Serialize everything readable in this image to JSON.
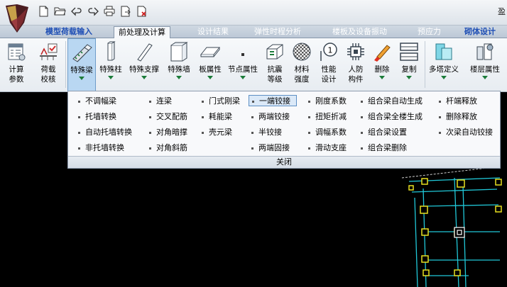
{
  "title": {
    "text": "盈"
  },
  "quick_access": [
    {
      "icon": "new-file-icon"
    },
    {
      "icon": "open-folder-icon"
    },
    {
      "icon": "undo-icon"
    },
    {
      "icon": "redo-icon"
    },
    {
      "icon": "print-icon"
    },
    {
      "icon": "export-icon"
    },
    {
      "icon": "close-file-icon"
    }
  ],
  "tabs": [
    {
      "label": "模型荷载输入"
    },
    {
      "label": "前处理及计算"
    },
    {
      "label": "设计结果"
    },
    {
      "label": "弹性时程分析"
    },
    {
      "label": "楼板及设备振动"
    },
    {
      "label": "预应力"
    },
    {
      "label": "砌体设计"
    }
  ],
  "ribbon": [
    {
      "label1": "计算",
      "label2": "参数",
      "icon": "calc-params-icon"
    },
    {
      "label1": "荷载",
      "label2": "校核",
      "icon": "load-check-icon"
    },
    {
      "label1": "特殊梁",
      "label2": "",
      "icon": "special-beam-icon"
    },
    {
      "label1": "特殊柱",
      "label2": "",
      "icon": "special-column-icon"
    },
    {
      "label1": "特殊支撑",
      "label2": "",
      "icon": "special-brace-icon"
    },
    {
      "label1": "特殊墙",
      "label2": "",
      "icon": "special-wall-icon"
    },
    {
      "label1": "板属性",
      "label2": "",
      "icon": "slab-property-icon"
    },
    {
      "label1": "节点属性",
      "label2": "",
      "icon": "node-property-icon"
    },
    {
      "label1": "抗震",
      "label2": "等级",
      "icon": "seismic-grade-icon"
    },
    {
      "label1": "材料",
      "label2": "强度",
      "icon": "material-strength-icon"
    },
    {
      "label1": "性能",
      "label2": "设计",
      "icon": "performance-design-icon"
    },
    {
      "label1": "人防",
      "label2": "构件",
      "icon": "civil-defense-icon"
    },
    {
      "label1": "删除",
      "label2": "",
      "icon": "delete-icon"
    },
    {
      "label1": "复制",
      "label2": "",
      "icon": "copy-icon"
    },
    {
      "label1": "多塔定义",
      "label2": "",
      "icon": "multi-tower-icon"
    },
    {
      "label1": "楼层属性",
      "label2": "",
      "icon": "floor-property-icon"
    }
  ],
  "dropdown": {
    "col1": [
      "不调幅梁",
      "托墙转换",
      "自动托墙转换",
      "非托墙转换"
    ],
    "col2": [
      "连梁",
      "交叉配筋",
      "对角暗撑",
      "对角斜筋"
    ],
    "col3": [
      "门式刚梁",
      "耗能梁",
      "壳元梁"
    ],
    "col4": [
      "一端铰接",
      "两端铰接",
      "半铰接",
      "两端固接"
    ],
    "col5": [
      "刚度系数",
      "扭矩折减",
      "调幅系数",
      "滑动支座"
    ],
    "col6": [
      "组合梁自动生成",
      "组合梁全楼生成",
      "组合梁设置",
      "组合梁删除"
    ],
    "col7": [
      "杆端释放",
      "删除释放",
      "次梁自动铰接"
    ],
    "close_label": "关闭"
  },
  "colors": {
    "drawing_background": "#000000",
    "structure_line": "#20c8d8",
    "node_marker": "#e8e020",
    "axis_line": "#cfcfcf"
  }
}
